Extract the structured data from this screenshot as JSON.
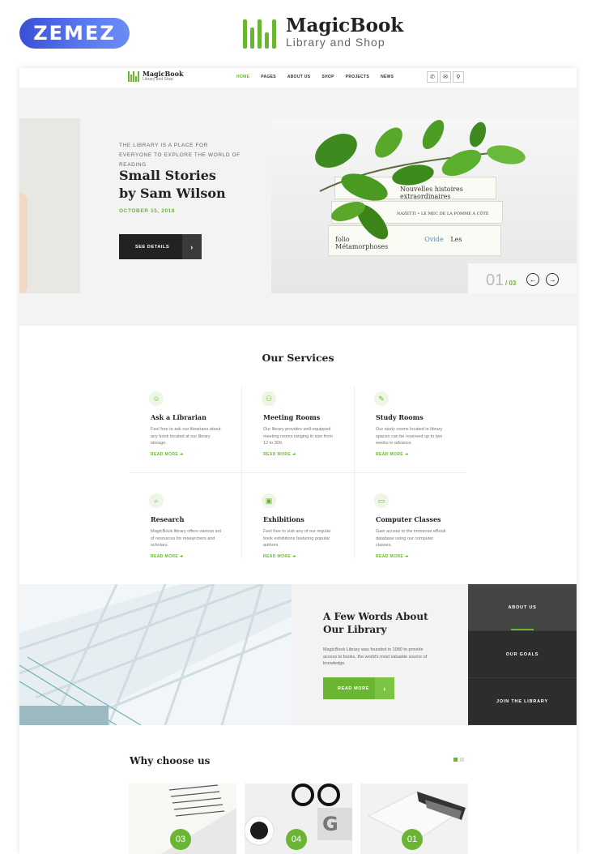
{
  "promo": {
    "vendor": "ZEMEZ",
    "brand_title": "MagicBook",
    "brand_subtitle": "Library and Shop"
  },
  "nav": {
    "logo_title": "MagicBook",
    "logo_subtitle": "Library and Shop",
    "links": [
      "HOME",
      "PAGES",
      "ABOUT US",
      "SHOP",
      "PROJECTS",
      "NEWS"
    ],
    "active_link": "HOME",
    "icons": [
      "phone-icon",
      "mail-icon",
      "location-icon"
    ]
  },
  "hero": {
    "eyebrow": "THE LIBRARY IS A PLACE FOR EVERYONE TO EXPLORE THE WORLD OF READING",
    "title_line1": "Small Stories",
    "title_line2": "by Sam Wilson",
    "date": "OCTOBER 15, 2018",
    "button": "SEE DETAILS",
    "button_arrow": "›",
    "books": [
      "Nouvelles histoires extraordinaires",
      "NAZETTI • LE MEC DE LA POMME À CÔTÉ",
      "folio",
      "Ovide",
      "Les Métamorphoses"
    ],
    "slide_current": "01",
    "slide_total": "/ 03",
    "prev_arrow": "←",
    "next_arrow": "→"
  },
  "services": {
    "title": "Our Services",
    "items": [
      {
        "icon": "librarian-icon",
        "glyph": "☺",
        "name": "Ask a Librarian",
        "desc": "Feel free to ask our librarians about any book located at our library storage.",
        "more": "READ MORE ➔"
      },
      {
        "icon": "meeting-icon",
        "glyph": "⚇",
        "name": "Meeting Rooms",
        "desc": "Our library provides well-equipped meeting rooms ranging in size from 12 to 300.",
        "more": "READ MORE ➔"
      },
      {
        "icon": "study-icon",
        "glyph": "✎",
        "name": "Study Rooms",
        "desc": "Our study rooms located in library spaces can be reserved up to two weeks in advance.",
        "more": "READ MORE ➔"
      },
      {
        "icon": "research-icon",
        "glyph": "⌕",
        "name": "Research",
        "desc": "MagicBook library offers various set of resources for researchers and scholars.",
        "more": "READ MORE ➔"
      },
      {
        "icon": "exhibitions-icon",
        "glyph": "▣",
        "name": "Exhibitions",
        "desc": "Feel free to visit any of our regular book exhibitions featuring popular authors.",
        "more": "READ MORE ➔"
      },
      {
        "icon": "computer-icon",
        "glyph": "▭",
        "name": "Computer Classes",
        "desc": "Gain access to the immense eBook database using our computer classes.",
        "more": "READ MORE ➔"
      }
    ]
  },
  "about": {
    "title_line1": "A Few Words About",
    "title_line2": "Our Library",
    "text": "MagicBook Library was founded in 1980 to provide access to books, the world's most valuable source of knowledge.",
    "button": "READ MORE",
    "button_arrow": "›",
    "tabs": [
      "ABOUT US",
      "OUR GOALS",
      "JOIN THE LIBRARY"
    ],
    "active_tab": "ABOUT US"
  },
  "why": {
    "title": "Why choose us",
    "cards": [
      "03",
      "04",
      "01"
    ]
  },
  "colors": {
    "accent": "#6ab633",
    "dark": "#222222"
  }
}
